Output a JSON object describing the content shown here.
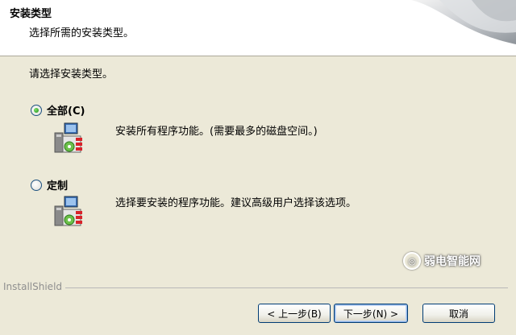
{
  "header": {
    "title": "安装类型",
    "subtitle": "选择所需的安装类型。"
  },
  "prompt": "请选择安装类型。",
  "options": [
    {
      "label": "全部(C)",
      "description": "安装所有程序功能。(需要最多的磁盘空间。)",
      "checked": true,
      "icon": "setup-complete-icon"
    },
    {
      "label": "定制",
      "description": "选择要安装的程序功能。建议高级用户选择该选项。",
      "checked": false,
      "icon": "setup-custom-icon"
    }
  ],
  "footer": {
    "brand": "InstallShield",
    "back_label": "< 上一步(B)",
    "next_label": "下一步(N) >",
    "cancel_label": "取消"
  },
  "watermark": {
    "text": "弱电智能网"
  }
}
